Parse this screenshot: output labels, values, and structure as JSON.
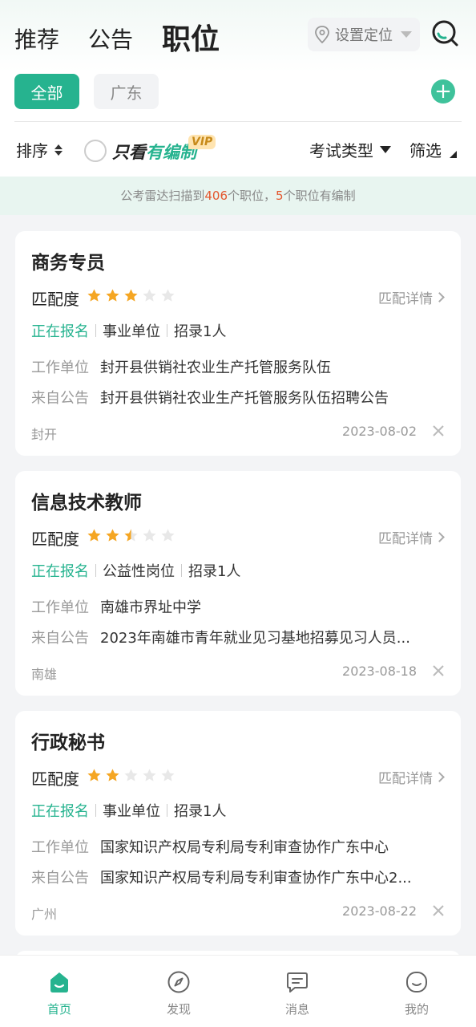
{
  "header": {
    "tabs": [
      "推荐",
      "公告",
      "职位"
    ],
    "active_tab": "职位",
    "location_label": "设置定位"
  },
  "regions": {
    "all": "全部",
    "region": "广东"
  },
  "filters": {
    "sort": "排序",
    "only_prefix": "只看",
    "only_highlight": "有编制",
    "vip": "VIP",
    "exam_type": "考试类型",
    "screen": "筛选"
  },
  "notice": {
    "prefix": "公考雷达扫描到",
    "total": "406",
    "middle": "个职位，",
    "count": "5",
    "suffix": "个职位有编制"
  },
  "labels": {
    "match": "匹配度",
    "match_detail": "匹配详情",
    "work_unit": "工作单位",
    "from_notice": "来自公告"
  },
  "jobs": [
    {
      "title": "商务专员",
      "stars": 3,
      "status": "正在报名",
      "unit_type": "事业单位",
      "recruit": "招录1人",
      "work_unit": "封开县供销社农业生产托管服务队伍",
      "notice": "封开县供销社农业生产托管服务队伍招聘公告",
      "city": "封开",
      "date": "2023-08-02"
    },
    {
      "title": "信息技术教师",
      "stars": 2.5,
      "status": "正在报名",
      "unit_type": "公益性岗位",
      "recruit": "招录1人",
      "work_unit": "南雄市界址中学",
      "notice": "2023年南雄市青年就业见习基地招募见习人员...",
      "city": "南雄",
      "date": "2023-08-18"
    },
    {
      "title": "行政秘书",
      "stars": 2,
      "status": "正在报名",
      "unit_type": "事业单位",
      "recruit": "招录1人",
      "work_unit": "国家知识产权局专利局专利审查协作广东中心",
      "notice": "国家知识产权局专利局专利审查协作广东中心2...",
      "city": "广州",
      "date": "2023-08-22"
    }
  ],
  "tabbar": [
    {
      "label": "首页",
      "icon": "home-icon"
    },
    {
      "label": "发现",
      "icon": "compass-icon"
    },
    {
      "label": "消息",
      "icon": "message-icon"
    },
    {
      "label": "我的",
      "icon": "profile-icon"
    }
  ],
  "colors": {
    "accent": "#26b38f",
    "star": "#f5a623",
    "highlight_number": "#e4572e"
  }
}
